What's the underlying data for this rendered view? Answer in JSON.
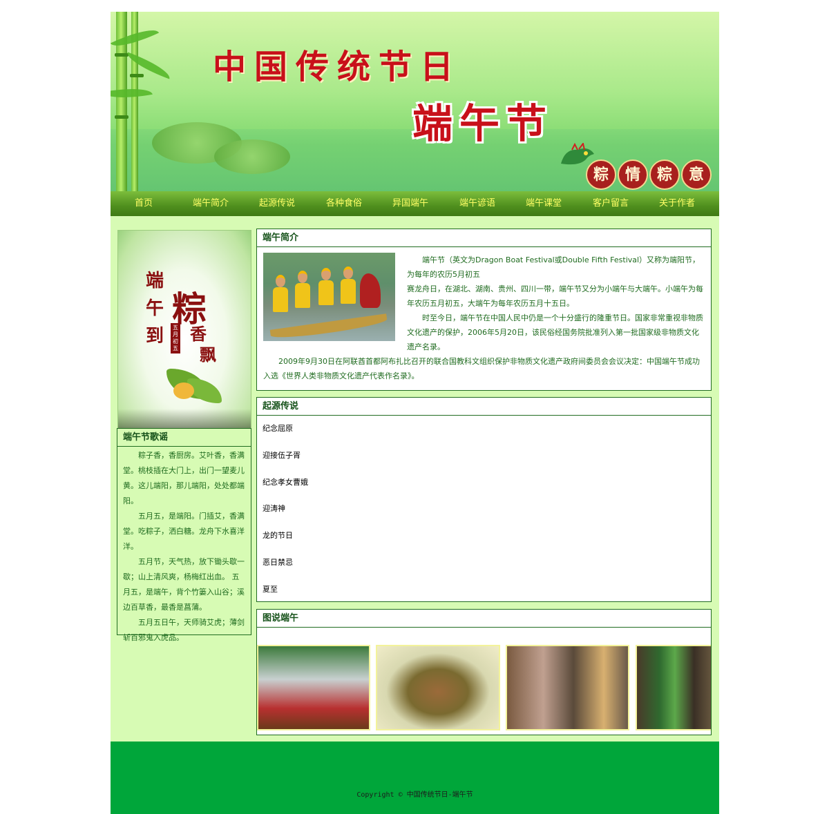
{
  "banner": {
    "title_line1": "中国传统节日",
    "title_line2": "端午节",
    "badges": [
      "粽",
      "情",
      "粽",
      "意"
    ]
  },
  "nav": [
    "首页",
    "端午简介",
    "起源传说",
    "各种食俗",
    "异国端午",
    "端午谚语",
    "端午课堂",
    "客户留言",
    "关于作者"
  ],
  "sidebar": {
    "poster_text": [
      "端",
      "午",
      "到",
      "粽",
      "香",
      "飘",
      "五月初五"
    ],
    "song_title": "端午节歌谣",
    "song_paragraphs": [
      "粽子香，香厨房。艾叶香，香满堂。桃枝插在大门上，出门一望麦儿黄。这儿端阳，那儿端阳，处处都端阳。",
      "五月五，是端阳。门插艾，香满堂。吃粽子，洒白糖。龙舟下水喜洋洋。",
      "五月节，天气热，放下锄头歇一歇；山上清风爽，杨梅红出血。 五月五，是端午，背个竹篓入山谷；溪边百草香，最香是菖蒲。",
      "五月五日午，天师骑艾虎；薄剑斩百邪鬼入虎品。"
    ]
  },
  "intro": {
    "title": "端午简介",
    "lines": [
      "端午节（英文为Dragon Boat Festival或Double Fifth Festival）又称为端阳节，为每年的农历5月初五",
      "赛龙舟日，在湖北、湖南、贵州、四川一带，端午节又分为小端午与大端午。小端午为每年农历五月初五，大端午为每年农历五月十五日。",
      "时至今日，端午节在中国人民中仍是一个十分盛行的隆重节日。国家非常重视非物质文化遗产的保护，2006年5月20日，该民俗经国务院批准列入第一批国家级非物质文化遗产名录。",
      "2009年9月30日在阿联酋首都阿布扎比召开的联合国教科文组织保护非物质文化遗产政府间委员会会议决定：中国端午节成功入选《世界人类非物质文化遗产代表作名录》。"
    ]
  },
  "origin": {
    "title": "起源传说",
    "items": [
      "纪念屈原",
      "迎接伍子胥",
      "纪念孝女曹娥",
      "迎涛神",
      "龙的节日",
      "恶日禁忌",
      "夏至"
    ]
  },
  "gallery": {
    "title": "图说端午",
    "photos": [
      "dragon-boat-race",
      "zongzi-bowl",
      "family-making-zongzi",
      "hanging-mugwort"
    ]
  },
  "footer": {
    "copyright": "Copyright © 中国传统节日-端午节"
  }
}
